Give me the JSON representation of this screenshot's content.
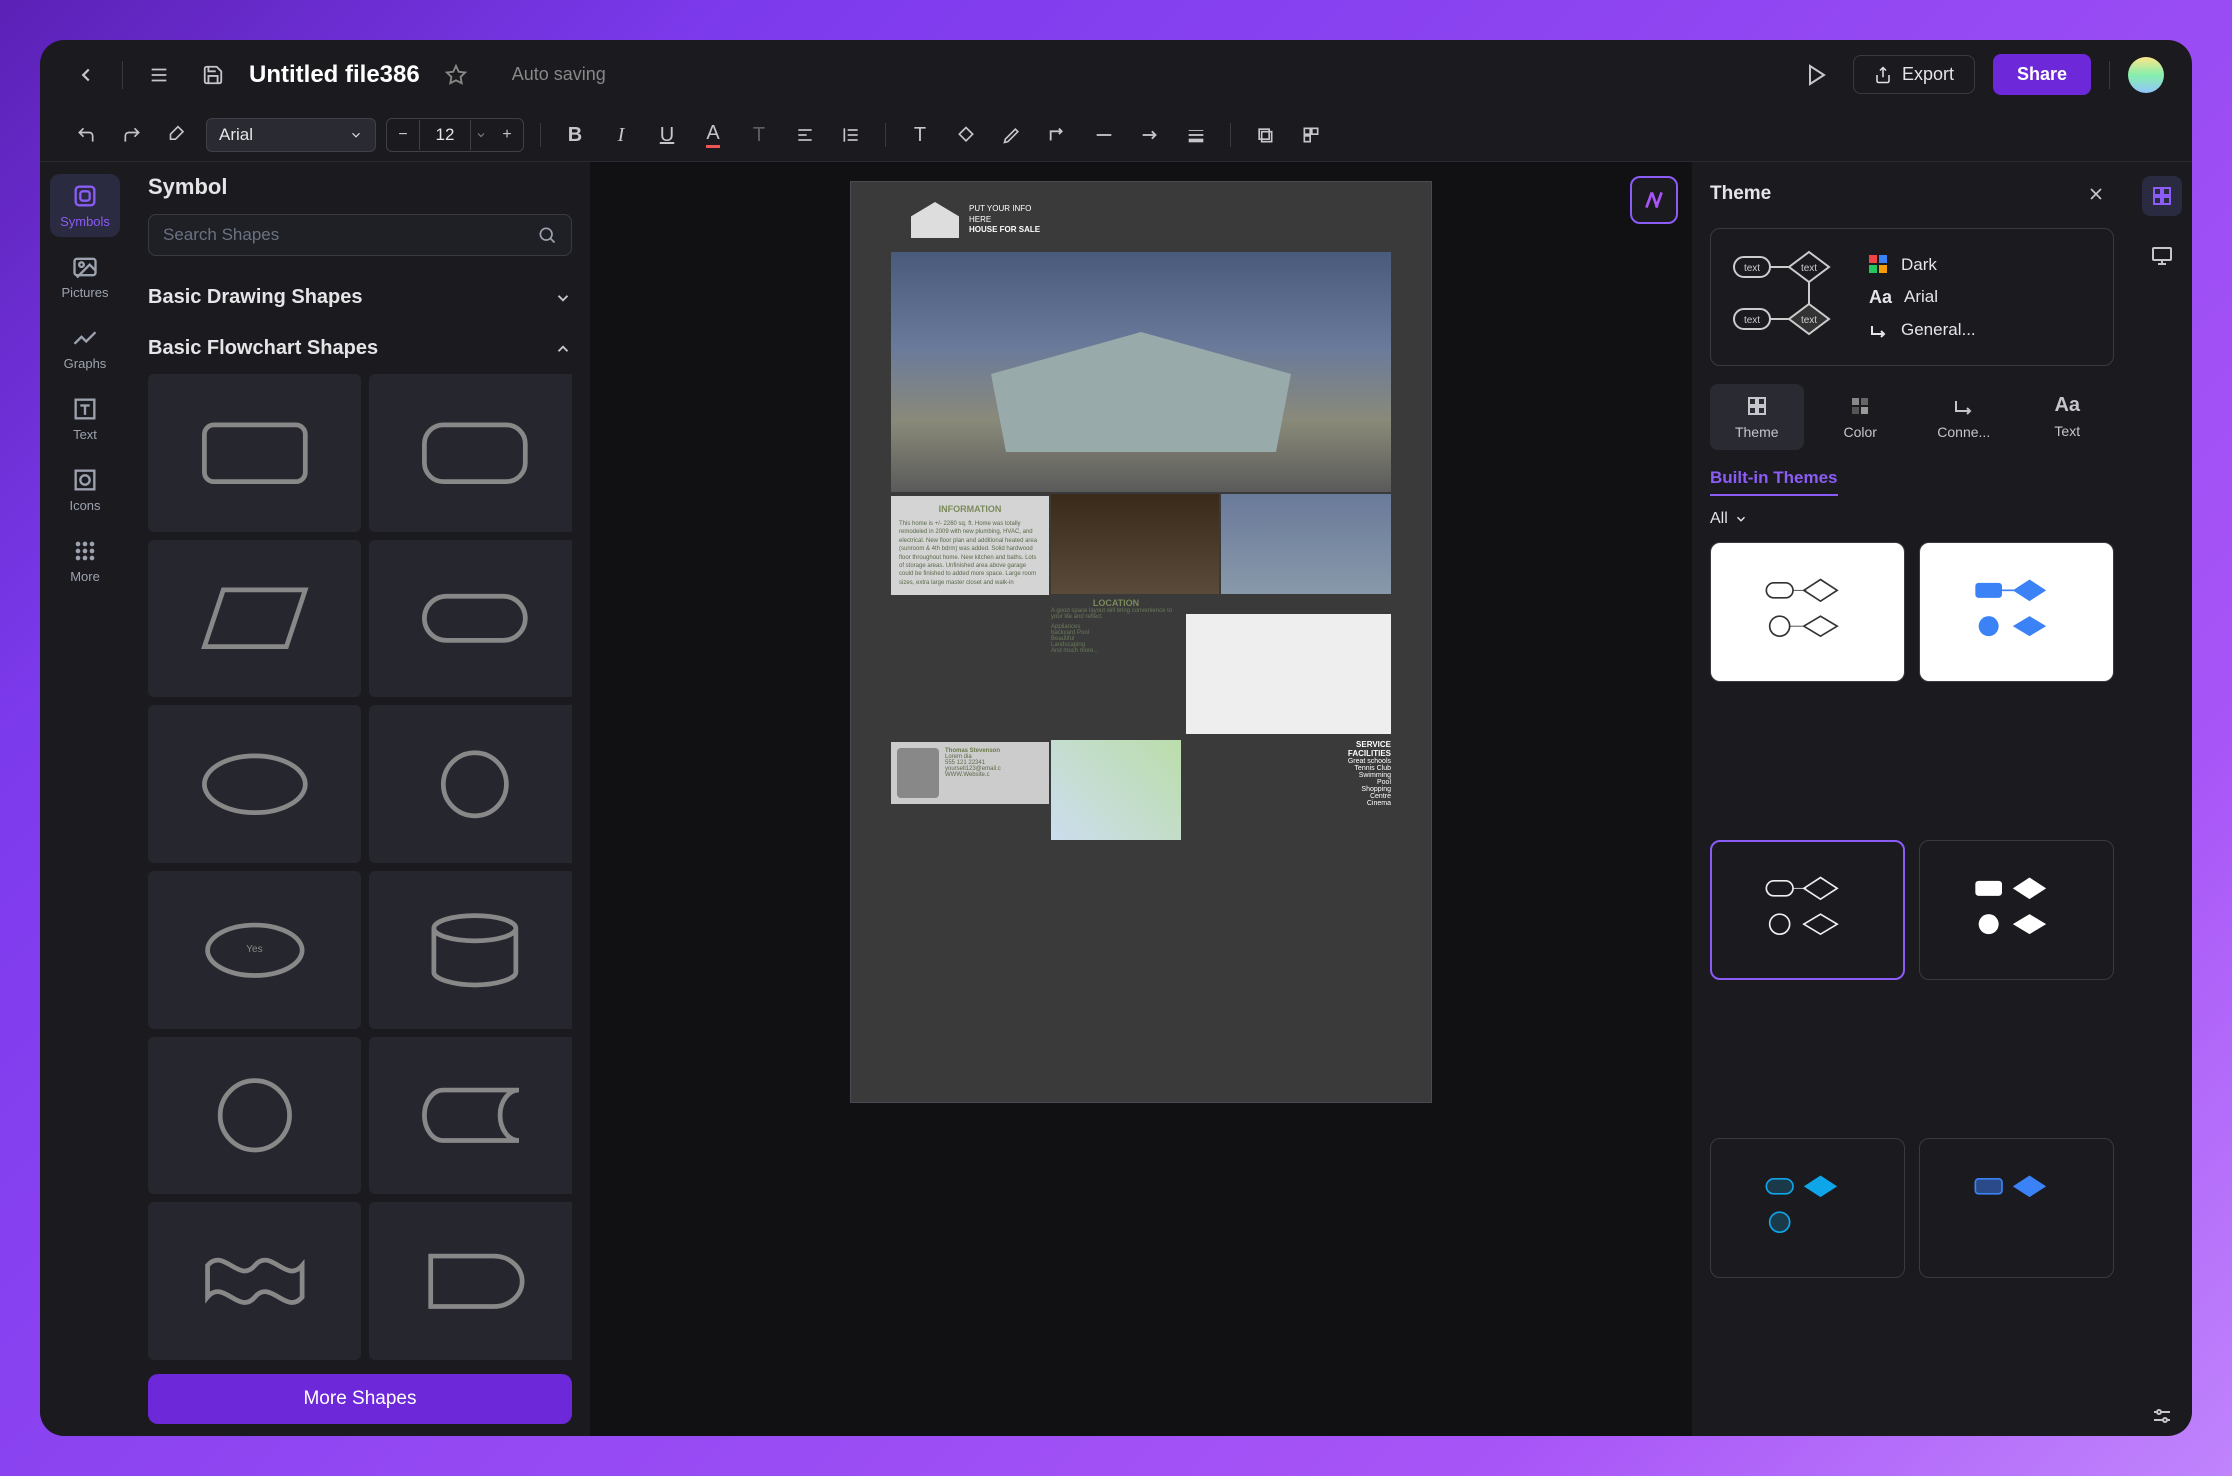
{
  "titlebar": {
    "file_name": "Untitled file386",
    "auto_save": "Auto saving",
    "export": "Export",
    "share": "Share"
  },
  "toolbar": {
    "font": "Arial",
    "size": "12"
  },
  "rail": {
    "symbols": "Symbols",
    "pictures": "Pictures",
    "graphs": "Graphs",
    "text": "Text",
    "icons": "Icons",
    "more": "More"
  },
  "left_panel": {
    "title": "Symbol",
    "search_placeholder": "Search Shapes",
    "section_basic": "Basic Drawing Shapes",
    "section_flowchart": "Basic Flowchart Shapes",
    "more_shapes": "More Shapes",
    "yes_label": "Yes"
  },
  "canvas": {
    "header1": "PUT YOUR INFO",
    "header2": "HERE",
    "header3": "HOUSE FOR SALE",
    "info_title": "INFORMATION",
    "info_body": "This home is +/- 2260 sq. ft. Home was totally remodeled in 2009 with new plumbing, HVAC, and electrical. New floor plan and additional heated area (sunroom & 4th bdrm) was added. Solid hardwood floor throughout home. New kitchen and baths. Lots of storage areas. Unfinished area above garage could be finished to added more space. Large room sizes, extra large master closet and walk-in",
    "loc_title": "LOCATION",
    "loc_body": "A good space layout will bring convenience to your life and reflect",
    "loc_items": [
      "Appliances",
      "backyard Pool",
      "Beautiful",
      "Landscaping",
      "And much more..."
    ],
    "contact_name": "Thomas Stevenson",
    "contact_addr": "Lorem dia",
    "contact_ph": "555 121 22341",
    "contact_email": "yoursell123@email.c",
    "contact_web": "WWW.Website.c",
    "svc_title1": "SERVICE",
    "svc_title2": "FACILITIES",
    "svc_items": [
      "Great schools",
      "Tennis Club",
      "Swimming",
      "Pool",
      "Shopping",
      "Centre",
      "Cinema"
    ]
  },
  "right_panel": {
    "title": "Theme",
    "prop_dark": "Dark",
    "prop_font": "Arial",
    "prop_conn": "General...",
    "tab_theme": "Theme",
    "tab_color": "Color",
    "tab_conn": "Conne...",
    "tab_text": "Text",
    "built_in": "Built-in Themes",
    "filter": "All"
  }
}
